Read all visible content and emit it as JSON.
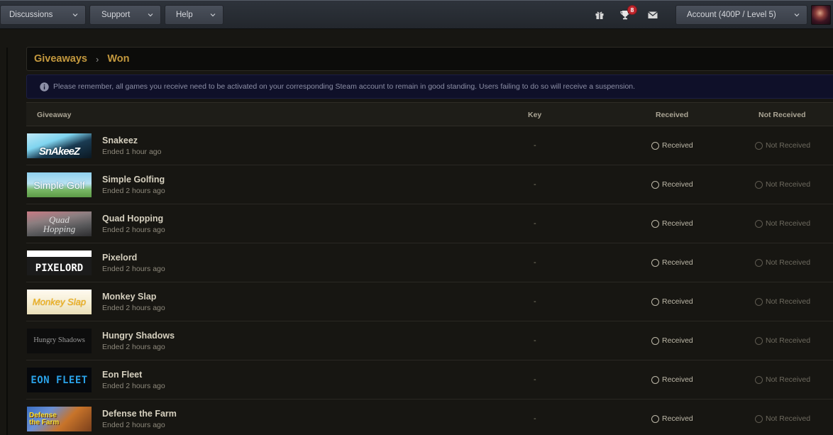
{
  "nav": {
    "discussions": "Discussions",
    "support": "Support",
    "help": "Help",
    "notification_count": "8",
    "account": "Account (400P / Level 5)"
  },
  "breadcrumb": {
    "section": "Giveaways",
    "separator": "›",
    "page": "Won"
  },
  "notice": "Please remember, all games you receive need to be activated on your corresponding Steam account to remain in good standing. Users failing to do so will receive a suspension.",
  "table": {
    "headers": {
      "giveaway": "Giveaway",
      "key": "Key",
      "received": "Received",
      "not_received": "Not Received"
    },
    "rows": [
      {
        "name": "Snakeez",
        "ended": "Ended 1 hour ago",
        "key": "-",
        "received": "Received",
        "not_received": "Not Received",
        "thumb_text": "SnAkeeZ"
      },
      {
        "name": "Simple Golfing",
        "ended": "Ended 2 hours ago",
        "key": "-",
        "received": "Received",
        "not_received": "Not Received",
        "thumb_text": "Simple Golf"
      },
      {
        "name": "Quad Hopping",
        "ended": "Ended 2 hours ago",
        "key": "-",
        "received": "Received",
        "not_received": "Not Received",
        "thumb_text": "Quad Hopping"
      },
      {
        "name": "Pixelord",
        "ended": "Ended 2 hours ago",
        "key": "-",
        "received": "Received",
        "not_received": "Not Received",
        "thumb_text": "PIXELORD"
      },
      {
        "name": "Monkey Slap",
        "ended": "Ended 2 hours ago",
        "key": "-",
        "received": "Received",
        "not_received": "Not Received",
        "thumb_text": "Monkey Slap"
      },
      {
        "name": "Hungry Shadows",
        "ended": "Ended 2 hours ago",
        "key": "-",
        "received": "Received",
        "not_received": "Not Received",
        "thumb_text": "Hungry Shadows"
      },
      {
        "name": "Eon Fleet",
        "ended": "Ended 2 hours ago",
        "key": "-",
        "received": "Received",
        "not_received": "Not Received",
        "thumb_text": "EON FLEET"
      },
      {
        "name": "Defense the Farm",
        "ended": "Ended 2 hours ago",
        "key": "-",
        "received": "Received",
        "not_received": "Not Received",
        "thumb_text": "Defense the Farm"
      }
    ]
  },
  "colors": {
    "accent": "#c4993e",
    "background": "#171612",
    "notice_bg": "#0f1029"
  }
}
